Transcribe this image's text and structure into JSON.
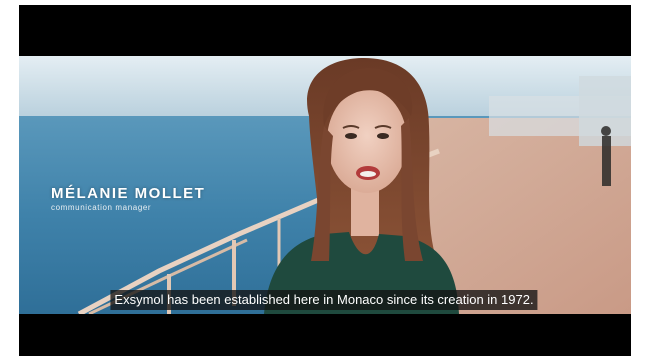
{
  "video": {
    "lower_third": {
      "name": "MÉLANIE MOLLET",
      "role": "communication manager"
    },
    "subtitle": "Exsymol has been established here in Monaco since its creation in 1972."
  }
}
